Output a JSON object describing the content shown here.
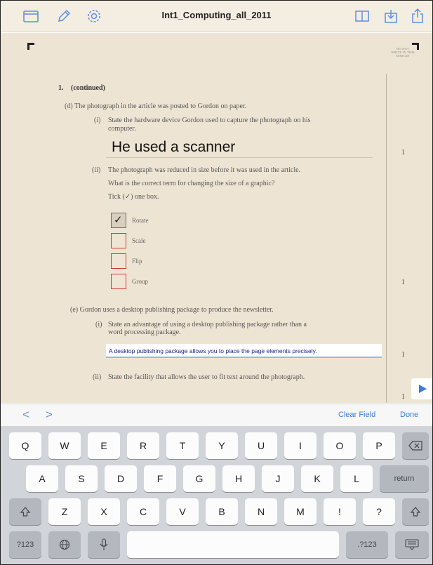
{
  "toolbar": {
    "title": "Int1_Computing_all_2011",
    "left_icons": [
      "folder-icon",
      "pencil-icon",
      "gear-icon"
    ],
    "right_icons": [
      "book-icon",
      "export-icon",
      "share-icon"
    ]
  },
  "document": {
    "margin_note": "DO NOT WRITE IN THIS MARGIN",
    "question_number": "1.",
    "question_label": "(continued)",
    "part_d": "(d)   The photograph in the article was posted to Gordon on paper.",
    "part_d_i_num": "(i)",
    "part_d_i_line1": "State the hardware device Gordon used to capture the photograph on his",
    "part_d_i_line2": "computer.",
    "answer_1": "He used a scanner",
    "part_d_ii_num": "(ii)",
    "part_d_ii_line1": "The photograph was reduced in size before it was used in the article.",
    "part_d_ii_line2": "What is the correct term for changing the size of a graphic?",
    "part_d_ii_line3": "Tick (✓) one box.",
    "options": [
      {
        "label": "Rotate",
        "checked": true
      },
      {
        "label": "Scale",
        "checked": false
      },
      {
        "label": "Flip",
        "checked": false
      },
      {
        "label": "Group",
        "checked": false
      }
    ],
    "part_e": "(e)   Gordon uses a desktop publishing package to produce the newsletter.",
    "part_e_i_num": "(i)",
    "part_e_i_line1": "State an advantage of using a desktop publishing package rather than a",
    "part_e_i_line2": "word processing package.",
    "answer_2": "A desktop publishing package allows you to place the page elements precisely.",
    "part_e_ii_num": "(ii)",
    "part_e_ii_line1": "State the facility that allows the user to fit text around the photograph.",
    "marks": [
      "1",
      "1",
      "1",
      "1"
    ]
  },
  "accessory": {
    "prev": "<",
    "next": ">",
    "clear_field": "Clear Field",
    "done": "Done"
  },
  "keyboard": {
    "row1": [
      "Q",
      "W",
      "E",
      "R",
      "T",
      "Y",
      "U",
      "I",
      "O",
      "P"
    ],
    "row2": [
      "A",
      "S",
      "D",
      "F",
      "G",
      "H",
      "J",
      "K",
      "L"
    ],
    "row3": [
      "Z",
      "X",
      "C",
      "V",
      "B",
      "N",
      "M",
      "!",
      "?"
    ],
    "return_label": "return",
    "numbers_label": ".?123",
    "numbers_label_left": "?123",
    "backspace_icon": "backspace-icon",
    "shift_icon": "shift-icon",
    "globe_icon": "globe-icon",
    "mic_icon": "microphone-icon",
    "dismiss_icon": "keyboard-dismiss-icon"
  },
  "colors": {
    "paper": "#eee4d3",
    "toolbar": "#f4ede2",
    "accent": "#3a7be0",
    "checkbox_border": "#d33a3a"
  }
}
